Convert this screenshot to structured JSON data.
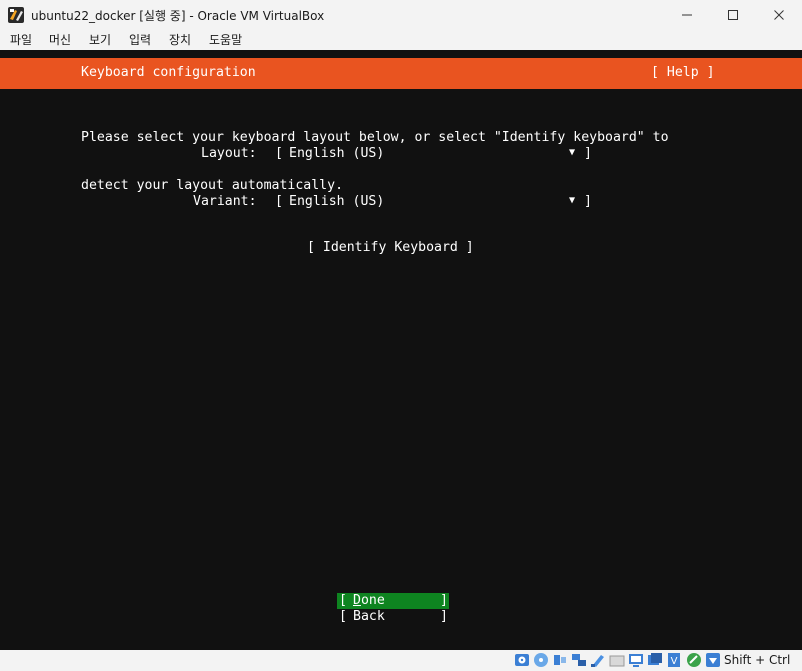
{
  "window": {
    "title": "ubuntu22_docker [실행 중] - Oracle VM VirtualBox",
    "minimize_glyph": "—",
    "maximize_glyph": "☐",
    "close_glyph": "✕"
  },
  "menu": {
    "items": [
      "파일",
      "머신",
      "보기",
      "입력",
      "장치",
      "도움말"
    ]
  },
  "installer": {
    "header_title": "Keyboard configuration",
    "help_button": "[ Help ]",
    "description_line1": "Please select your keyboard layout below, or select \"Identify keyboard\" to",
    "description_line2": "detect your layout automatically.",
    "layout": {
      "label": "Layout:",
      "value": "English (US)"
    },
    "variant": {
      "label": "Variant:",
      "value": "English (US)"
    },
    "dropdown_left": "[",
    "dropdown_right": "]",
    "dropdown_arrow": "▼",
    "identify_button": "[ Identify Keyboard ]",
    "done": {
      "first": "D",
      "rest": "one"
    },
    "back": {
      "label": "Back"
    },
    "bracket_left": "[",
    "bracket_right": "]"
  },
  "statusbar": {
    "host_key": "Shift + Ctrl"
  },
  "colors": {
    "header": "#e95420",
    "selected_button": "#0e8420",
    "screen_background": "#111111"
  },
  "icons": {
    "app": "virtualbox-icon",
    "status": [
      "hard-disk-icon",
      "optical-drive-icon",
      "audio-icon",
      "network-icon",
      "usb-icon",
      "shared-folder-icon",
      "display-icon",
      "recording-icon",
      "cpu-icon",
      "mouse-integration-icon",
      "keyboard-capture-icon"
    ]
  }
}
